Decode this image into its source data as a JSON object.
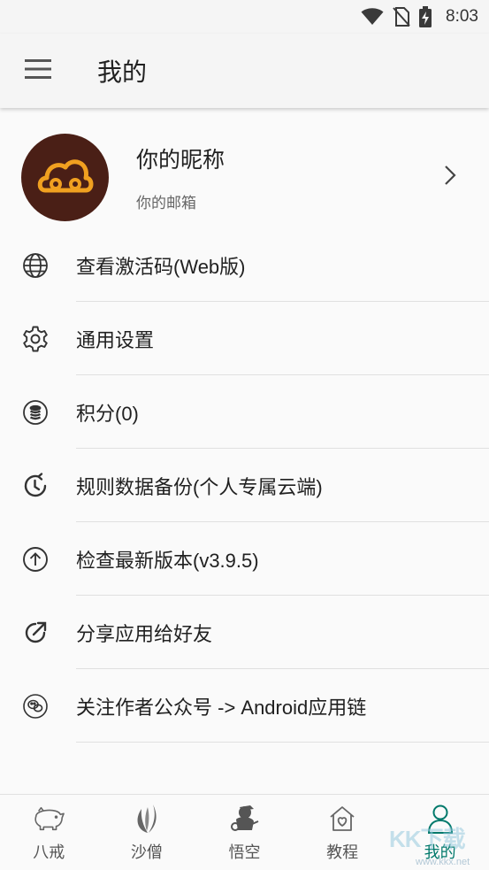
{
  "status_bar": {
    "time": "8:03",
    "icons": [
      "wifi-icon",
      "no-sim-icon",
      "battery-charging-icon"
    ]
  },
  "app_bar": {
    "title": "我的",
    "menu_icon": "hamburger-menu-icon"
  },
  "profile": {
    "nickname": "你的昵称",
    "email": "你的邮箱",
    "avatar_color": "#4a1f16",
    "avatar_accent": "#f0a020"
  },
  "menu": {
    "items": [
      {
        "label": "查看激活码(Web版)",
        "icon": "globe-icon"
      },
      {
        "label": "通用设置",
        "icon": "gear-icon"
      },
      {
        "label": "积分(0)",
        "icon": "coins-icon"
      },
      {
        "label": "规则数据备份(个人专属云端)",
        "icon": "backup-clock-icon"
      },
      {
        "label": "检查最新版本(v3.9.5)",
        "icon": "arrow-up-circle-icon"
      },
      {
        "label": "分享应用给好友",
        "icon": "share-external-icon"
      },
      {
        "label": "关注作者公众号 -> Android应用链",
        "icon": "wechat-icon"
      }
    ]
  },
  "bottom_nav": {
    "items": [
      {
        "label": "八戒",
        "icon": "pig-icon"
      },
      {
        "label": "沙僧",
        "icon": "leaf-icon"
      },
      {
        "label": "悟空",
        "icon": "monkey-icon"
      },
      {
        "label": "教程",
        "icon": "home-heart-icon"
      },
      {
        "label": "我的",
        "icon": "person-icon",
        "active": true
      }
    ],
    "active_color": "#00796b"
  },
  "watermark": {
    "text": "KK下载",
    "url": "www.kkx.net"
  }
}
